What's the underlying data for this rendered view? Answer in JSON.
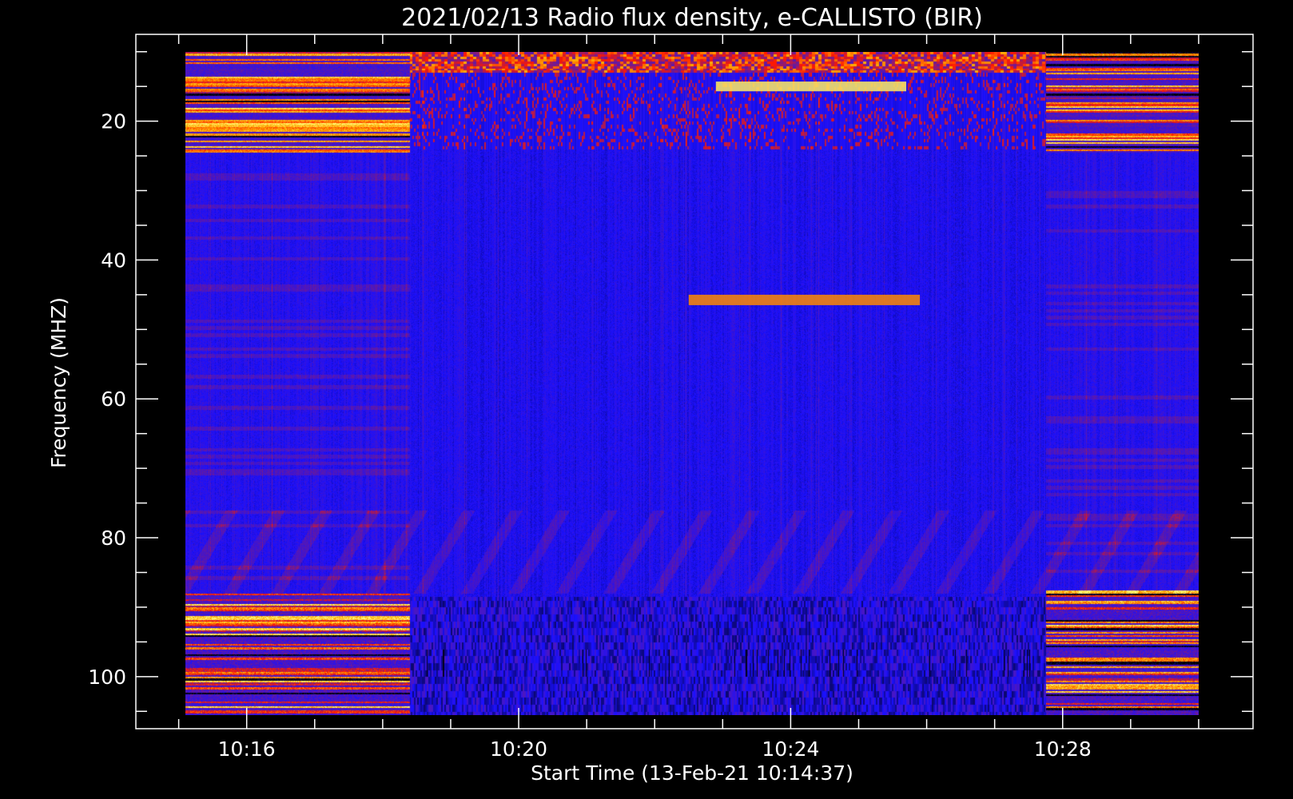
{
  "chart_data": {
    "type": "heatmap",
    "title": "2021/02/13  Radio flux density, e-CALLISTO (BIR)",
    "xlabel": "Start Time (13-Feb-21 10:14:37)",
    "ylabel": "Frequency (MHZ)",
    "x_ticks": [
      "10:16",
      "10:20",
      "10:24",
      "10:28"
    ],
    "y_ticks": [
      20,
      40,
      60,
      80,
      100
    ],
    "xlim_minutes_after_10_00": [
      14.37,
      30.8
    ],
    "ylim": [
      107.5,
      7.5
    ],
    "y_inverted": true,
    "data_time_range_minutes": [
      15.1,
      30.0
    ],
    "data_freq_range_mhz": [
      10,
      105.5
    ],
    "colormap": [
      "#000000",
      "#1a10ff",
      "#6a1a9a",
      "#ff1800",
      "#ffa800",
      "#ffff80"
    ],
    "bursts": [
      {
        "t_start": 22.5,
        "t_end": 25.9,
        "f_low": 45,
        "f_high": 46.5,
        "peak": "orange"
      },
      {
        "t_start": 22.9,
        "t_end": 25.7,
        "f_low": 14.3,
        "f_high": 15.7,
        "peak": "yellow"
      }
    ]
  }
}
